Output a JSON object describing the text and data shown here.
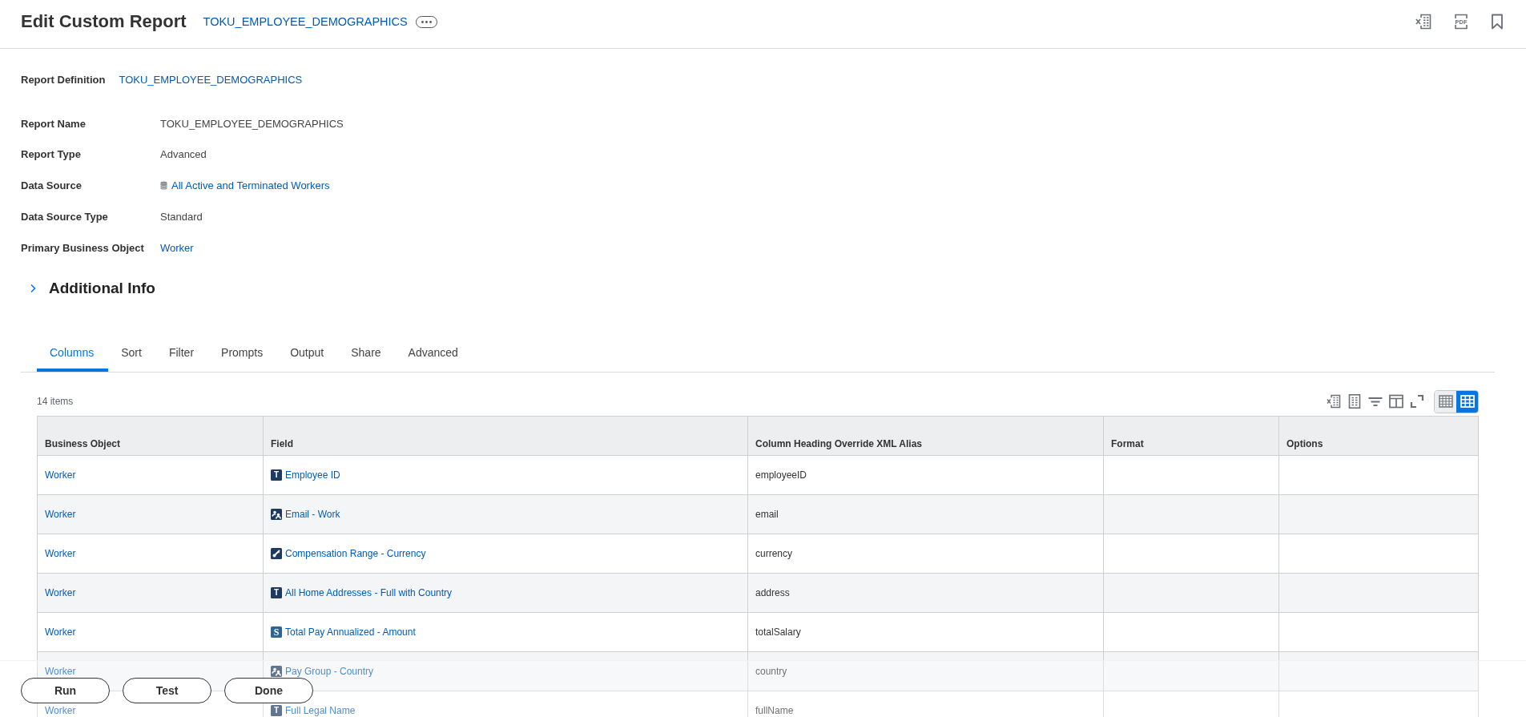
{
  "header": {
    "title": "Edit Custom Report",
    "report_link": "TOKU_EMPLOYEE_DEMOGRAPHICS",
    "pdf_label": "PDF"
  },
  "report_definition": {
    "label": "Report Definition",
    "value": "TOKU_EMPLOYEE_DEMOGRAPHICS"
  },
  "details": [
    {
      "label": "Report Name",
      "value": "TOKU_EMPLOYEE_DEMOGRAPHICS",
      "kind": "text"
    },
    {
      "label": "Report Type",
      "value": "Advanced",
      "kind": "text"
    },
    {
      "label": "Data Source",
      "value": "All Active and Terminated Workers",
      "kind": "source_link"
    },
    {
      "label": "Data Source Type",
      "value": "Standard",
      "kind": "text"
    },
    {
      "label": "Primary Business Object",
      "value": "Worker",
      "kind": "link"
    }
  ],
  "additional_info": {
    "title": "Additional Info",
    "expanded": false
  },
  "tabs": [
    {
      "label": "Columns",
      "selected": true
    },
    {
      "label": "Sort",
      "selected": false
    },
    {
      "label": "Filter",
      "selected": false
    },
    {
      "label": "Prompts",
      "selected": false
    },
    {
      "label": "Output",
      "selected": false
    },
    {
      "label": "Share",
      "selected": false
    },
    {
      "label": "Advanced",
      "selected": false
    }
  ],
  "table": {
    "item_count": "14 items",
    "view_modes": [
      {
        "kind": "compact",
        "selected": false
      },
      {
        "kind": "grid",
        "selected": true
      }
    ],
    "columns": [
      "Business Object",
      "Field",
      "Column Heading Override XML Alias",
      "Format",
      "Options"
    ],
    "rows": [
      {
        "business_object": "Worker",
        "field": {
          "kind": "text",
          "glyph": "T",
          "label": "Employee ID"
        },
        "alias": "employeeID"
      },
      {
        "business_object": "Worker",
        "field": {
          "kind": "group",
          "label": "Email - Work"
        },
        "alias": "email"
      },
      {
        "business_object": "Worker",
        "field": {
          "kind": "link",
          "label": "Compensation Range - Currency"
        },
        "alias": "currency"
      },
      {
        "business_object": "Worker",
        "field": {
          "kind": "text",
          "glyph": "T",
          "label": "All Home Addresses - Full with Country"
        },
        "alias": "address"
      },
      {
        "business_object": "Worker",
        "field": {
          "kind": "currency",
          "glyph": "S",
          "label": "Total Pay Annualized - Amount"
        },
        "alias": "totalSalary"
      },
      {
        "business_object": "Worker",
        "field": {
          "kind": "group",
          "label": "Pay Group - Country"
        },
        "alias": "country"
      },
      {
        "business_object": "Worker",
        "field": {
          "kind": "text",
          "glyph": "T",
          "label": "Full Legal Name"
        },
        "alias": "fullName"
      }
    ]
  },
  "actions": [
    "Run",
    "Test",
    "Done"
  ]
}
